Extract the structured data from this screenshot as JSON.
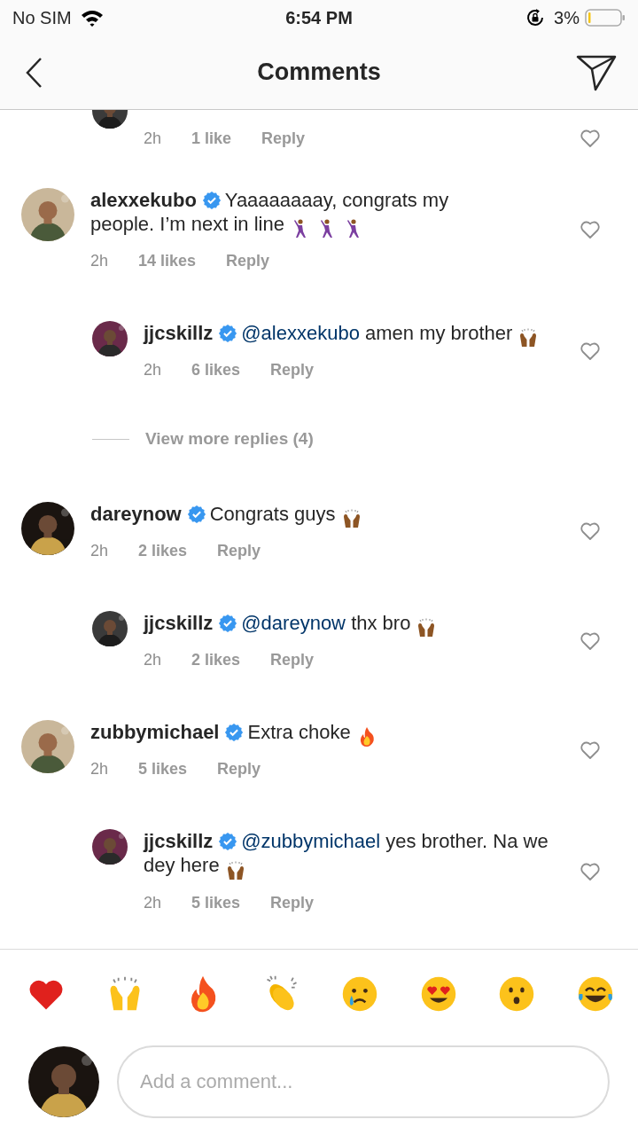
{
  "status_bar": {
    "carrier": "No SIM",
    "time": "6:54 PM",
    "battery": "3%"
  },
  "header": {
    "title": "Comments"
  },
  "comments": [
    {
      "kind": "reply",
      "time": "2h",
      "likes": "1 like",
      "reply": "Reply"
    },
    {
      "kind": "comment",
      "user": "alexxekubo",
      "verified": true,
      "text": "Yaaaaaaaay, congrats my people.  I’m next in line",
      "emojis": [
        {
          "kind": "dancer"
        },
        {
          "kind": "dancer"
        },
        {
          "kind": "dancer"
        }
      ],
      "time": "2h",
      "likes": "14 likes",
      "reply": "Reply"
    },
    {
      "kind": "reply",
      "user": "jjcskillz",
      "verified": true,
      "mention": "@alexxekubo",
      "text": "amen my brother",
      "emojis": [
        {
          "kind": "raised-hands"
        }
      ],
      "time": "2h",
      "likes": "6 likes",
      "reply": "Reply"
    },
    {
      "kind": "more",
      "text": "View more replies (4)"
    },
    {
      "kind": "comment",
      "user": "dareynow",
      "verified": true,
      "text": "Congrats guys",
      "emojis": [
        {
          "kind": "raised-hands"
        }
      ],
      "time": "2h",
      "likes": "2 likes",
      "reply": "Reply"
    },
    {
      "kind": "reply",
      "user": "jjcskillz",
      "verified": true,
      "mention": "@dareynow",
      "text": "thx bro",
      "emojis": [
        {
          "kind": "raised-hands"
        }
      ],
      "time": "2h",
      "likes": "2 likes",
      "reply": "Reply"
    },
    {
      "kind": "comment",
      "user": "zubbymichael",
      "verified": true,
      "text": "Extra choke",
      "emojis": [
        {
          "kind": "fire"
        }
      ],
      "time": "2h",
      "likes": "5 likes",
      "reply": "Reply"
    },
    {
      "kind": "reply",
      "user": "jjcskillz",
      "verified": true,
      "mention": "@zubbymichael",
      "text": "yes brother. Na we dey here",
      "emojis": [
        {
          "kind": "raised-hands"
        }
      ],
      "time": "2h",
      "likes": "5 likes",
      "reply": "Reply"
    }
  ],
  "reactions": [
    {
      "kind": "heart"
    },
    {
      "kind": "raised-hands"
    },
    {
      "kind": "fire"
    },
    {
      "kind": "clap"
    },
    {
      "kind": "crying"
    },
    {
      "kind": "heart-eyes"
    },
    {
      "kind": "surprised"
    },
    {
      "kind": "laughing"
    }
  ],
  "composer": {
    "placeholder": "Add a comment..."
  }
}
